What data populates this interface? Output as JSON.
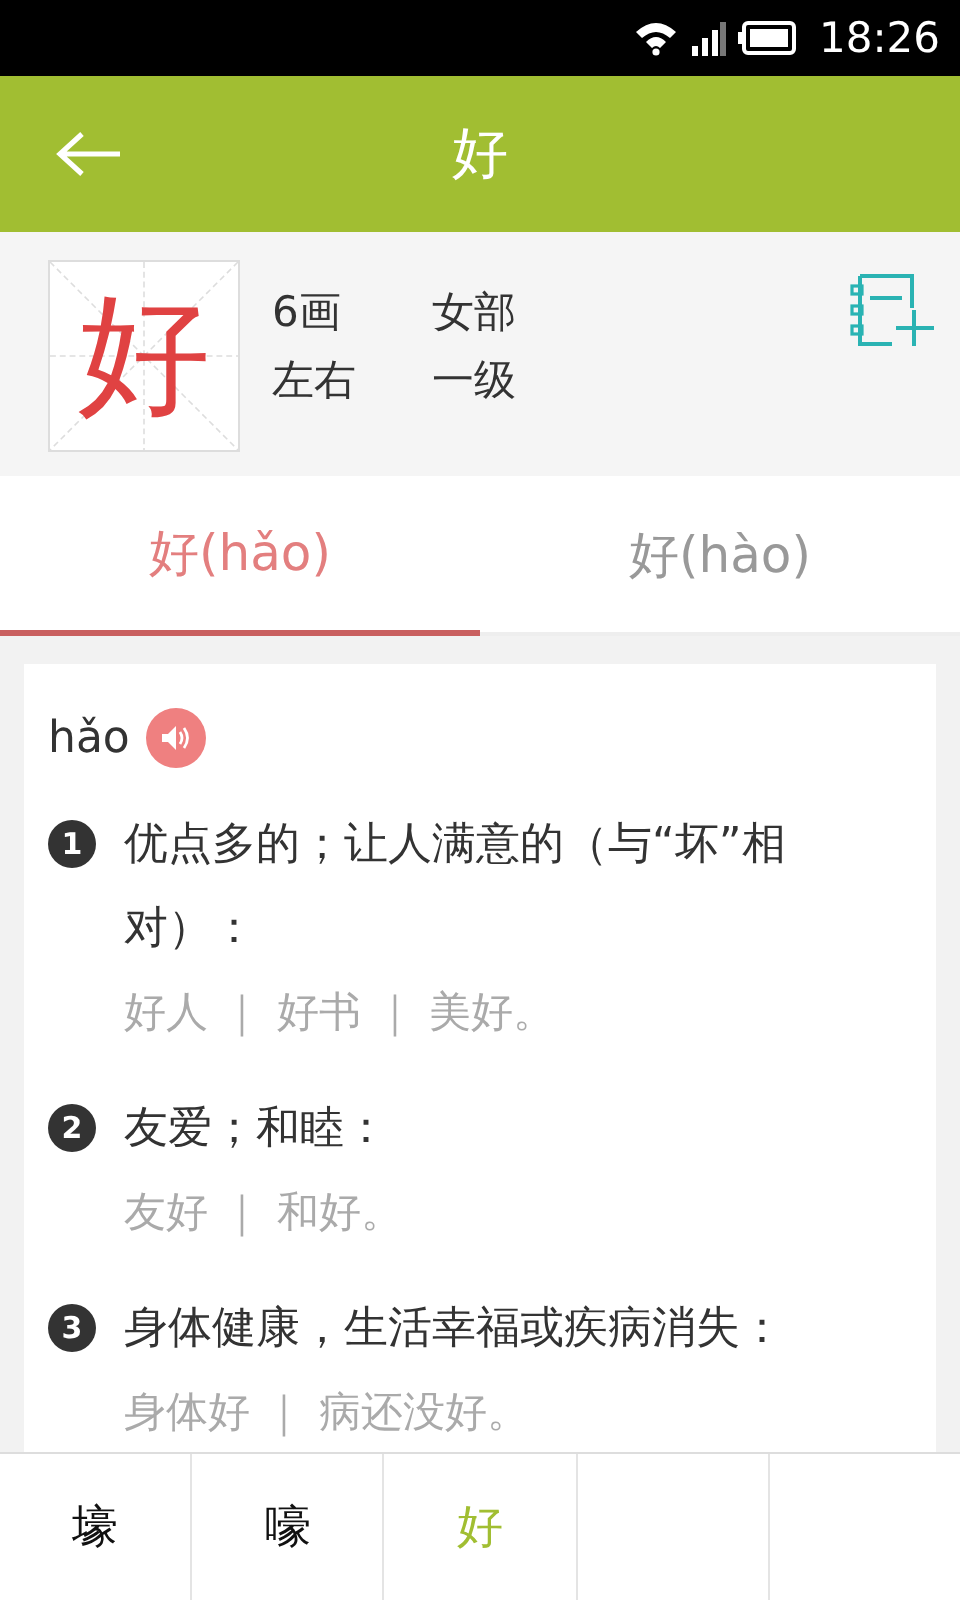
{
  "status_bar": {
    "time": "18:26"
  },
  "header": {
    "title": "好"
  },
  "character": {
    "glyph": "好",
    "strokes": "6画",
    "radical": "女部",
    "structure": "左右",
    "level": "一级"
  },
  "tabs": [
    {
      "label": "好(hǎo)",
      "selected": true
    },
    {
      "label": "好(hào)",
      "selected": false
    }
  ],
  "entry": {
    "pinyin": "hǎo",
    "definitions": [
      {
        "number": "1",
        "text": "优点多的；让人满意的（与“坏”相对）：",
        "examples": "好人 ｜ 好书 ｜ 美好。"
      },
      {
        "number": "2",
        "text": "友爱；和睦：",
        "examples": "友好 ｜ 和好。"
      },
      {
        "number": "3",
        "text": "身体健康，生活幸福或疾病消失：",
        "examples": "身体好 ｜ 病还没好。"
      }
    ]
  },
  "bottom_nav": [
    {
      "label": "壕",
      "selected": false
    },
    {
      "label": "嚎",
      "selected": false
    },
    {
      "label": "好",
      "selected": true
    }
  ]
}
